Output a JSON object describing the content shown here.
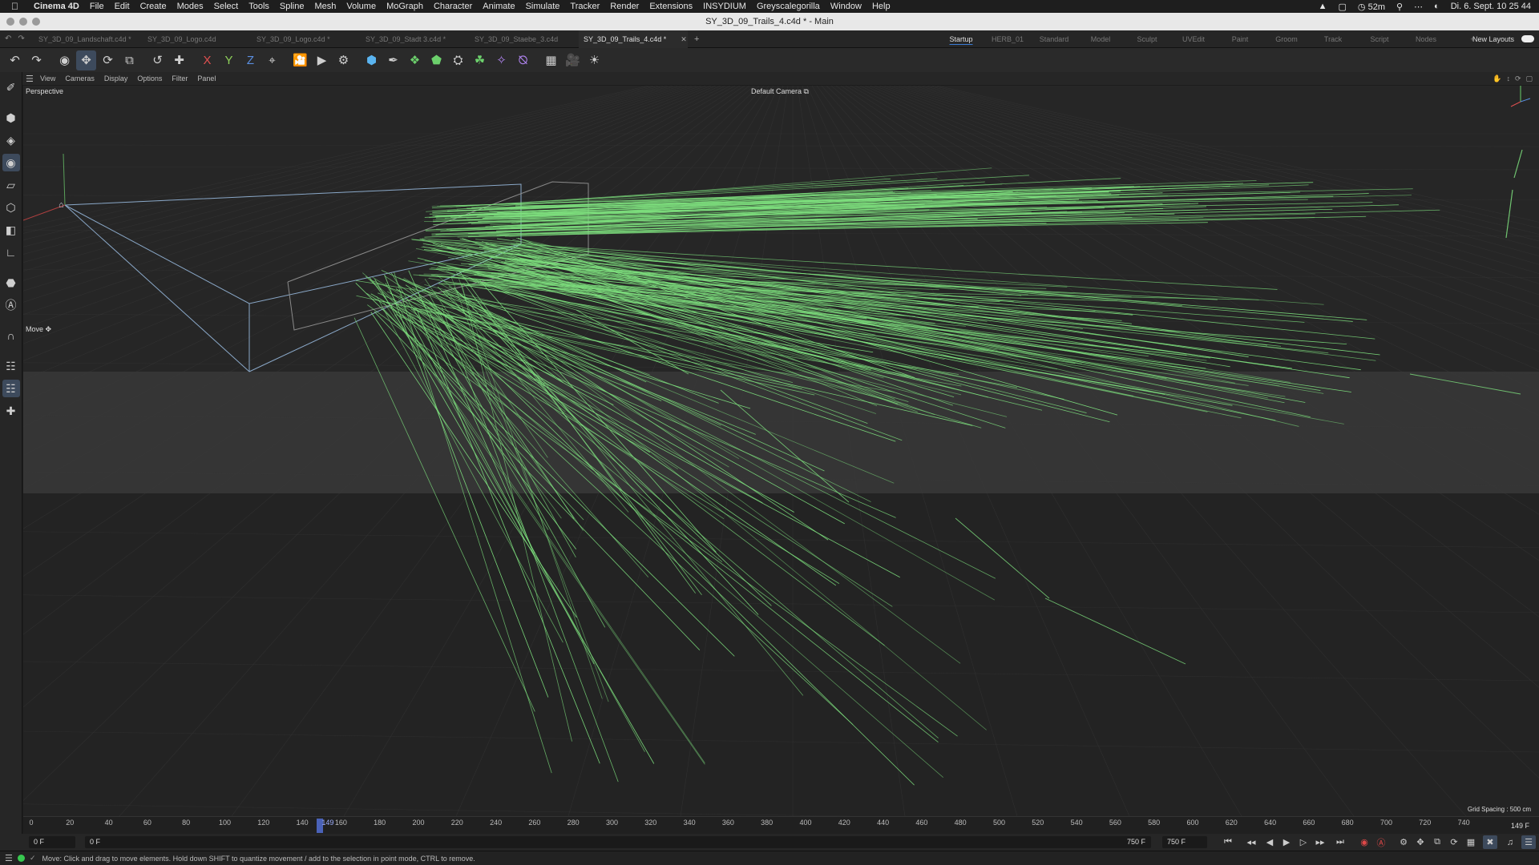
{
  "menubar": {
    "app": "Cinema 4D",
    "items": [
      "File",
      "Edit",
      "Create",
      "Modes",
      "Select",
      "Tools",
      "Spline",
      "Mesh",
      "Volume",
      "MoGraph",
      "Character",
      "Animate",
      "Simulate",
      "Tracker",
      "Render",
      "Extensions",
      "INSYDIUM",
      "Greyscalegorilla",
      "Window",
      "Help"
    ],
    "battery": "52m",
    "datetime": "Di. 6. Sept.  10 25 44"
  },
  "window": {
    "title": "SY_3D_09_Trails_4.c4d * - Main"
  },
  "tabs": {
    "documents": [
      {
        "label": "SY_3D_09_Landschaft.c4d *",
        "active": false
      },
      {
        "label": "SY_3D_09_Logo.c4d",
        "active": false
      },
      {
        "label": "SY_3D_09_Logo.c4d *",
        "active": false
      },
      {
        "label": "SY_3D_09_Stadt 3.c4d *",
        "active": false
      },
      {
        "label": "SY_3D_09_Staebe_3.c4d",
        "active": false
      },
      {
        "label": "SY_3D_09_Trails_4.c4d *",
        "active": true
      }
    ],
    "layouts": [
      "Startup",
      "HERB_01",
      "Standard",
      "Model",
      "Sculpt",
      "UVEdit",
      "Paint",
      "Groom",
      "Track",
      "Script",
      "Nodes"
    ],
    "active_layout": "Startup",
    "new_layouts": "New Layouts"
  },
  "toolbar": {
    "axis_x": "X",
    "axis_y": "Y",
    "axis_z": "Z"
  },
  "viewmenu": {
    "items": [
      "View",
      "Cameras",
      "Display",
      "Options",
      "Filter",
      "Panel"
    ]
  },
  "viewport": {
    "projection": "Perspective",
    "camera": "Default Camera",
    "tool_hint": "Move",
    "grid_spacing": "Grid Spacing : 500 cm",
    "colors": {
      "background": "#262626",
      "trails": "#7ee07e",
      "wire": "#8aa8c8"
    }
  },
  "timeline": {
    "ticks": [
      "0",
      "20",
      "40",
      "60",
      "80",
      "100",
      "120",
      "140",
      "160",
      "180",
      "200",
      "220",
      "240",
      "260",
      "280",
      "300",
      "320",
      "340",
      "360",
      "380",
      "400",
      "420",
      "440",
      "460",
      "480",
      "500",
      "520",
      "540",
      "560",
      "580",
      "600",
      "620",
      "640",
      "660",
      "680",
      "700",
      "720",
      "740"
    ],
    "current_frame_marker": "149",
    "end_label": "149 F"
  },
  "transport": {
    "start_frame": "0 F",
    "current_frame": "0 F",
    "end_frame_a": "750 F",
    "end_frame_b": "750 F"
  },
  "status": {
    "message": "Move: Click and drag to move elements. Hold down SHIFT to quantize movement / add to the selection in point mode, CTRL to remove."
  }
}
